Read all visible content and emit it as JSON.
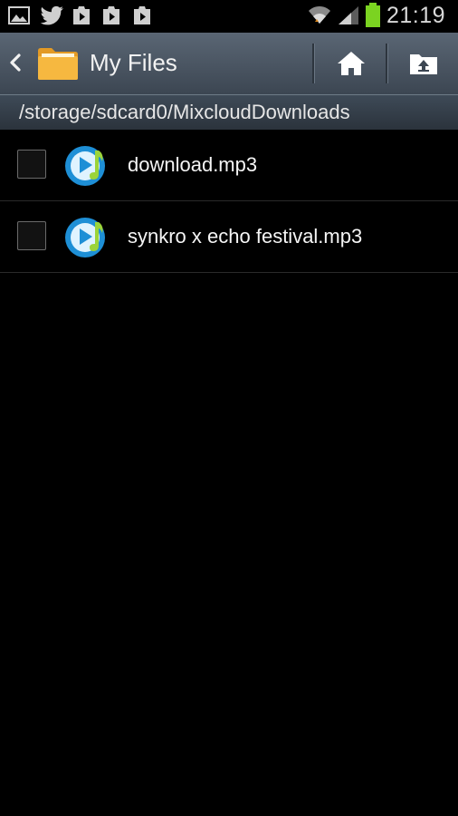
{
  "status_bar": {
    "time": "21:19",
    "notification_icons": [
      "gallery-icon",
      "twitter-icon",
      "play-store-icon",
      "play-store-icon",
      "play-store-icon"
    ],
    "battery_color": "#7bd321"
  },
  "action_bar": {
    "title": "My Files",
    "home_icon": "home-icon",
    "up_icon": "folder-up-icon"
  },
  "path_bar": {
    "path": "/storage/sdcard0/MixcloudDownloads"
  },
  "files": [
    {
      "name": "download.mp3",
      "checked": false,
      "icon": "audio-file-icon"
    },
    {
      "name": "synkro x echo festival.mp3",
      "checked": false,
      "icon": "audio-file-icon"
    }
  ],
  "colors": {
    "action_bar": "#4b5663",
    "background": "#000000",
    "folder": "#f2a933",
    "audio_icon": "#1e8fd6",
    "audio_note": "#9bd43a"
  }
}
